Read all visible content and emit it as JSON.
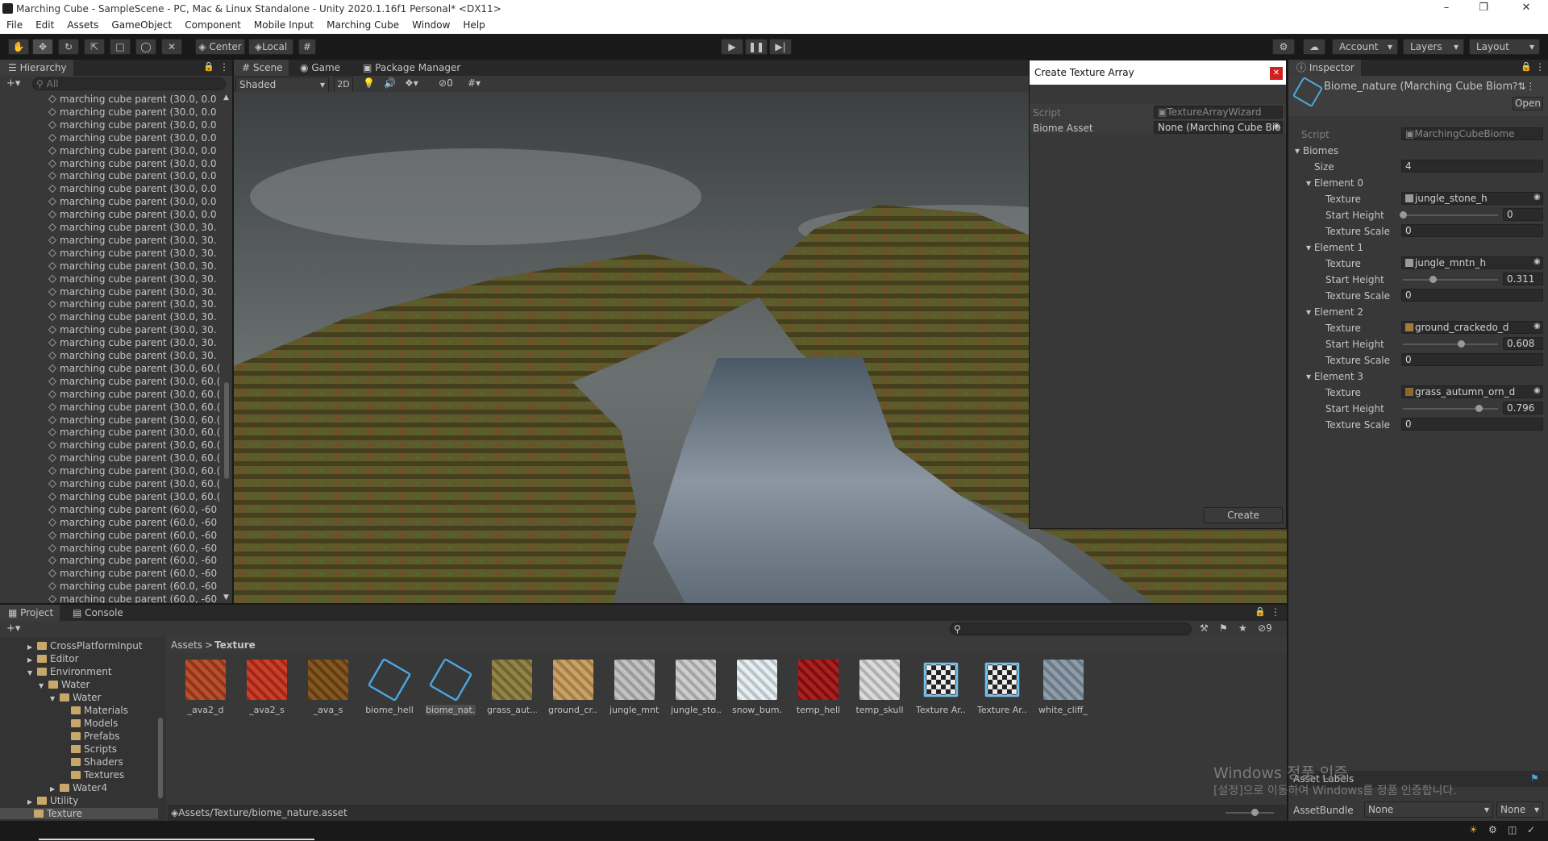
{
  "window": {
    "title": "Marching Cube - SampleScene - PC, Mac & Linux Standalone - Unity 2020.1.16f1 Personal* <DX11>"
  },
  "menu": [
    "File",
    "Edit",
    "Assets",
    "GameObject",
    "Component",
    "Mobile Input",
    "Marching Cube",
    "Window",
    "Help"
  ],
  "toolbar": {
    "pivot": "Center",
    "space": "Local",
    "account": "Account",
    "layers": "Layers",
    "layout": "Layout"
  },
  "hierarchy": {
    "tab": "Hierarchy",
    "search_placeholder": "All",
    "rows": [
      "marching cube parent (30.0, 0.0",
      "marching cube parent (30.0, 0.0",
      "marching cube parent (30.0, 0.0",
      "marching cube parent (30.0, 0.0",
      "marching cube parent (30.0, 0.0",
      "marching cube parent (30.0, 0.0",
      "marching cube parent (30.0, 0.0",
      "marching cube parent (30.0, 0.0",
      "marching cube parent (30.0, 0.0",
      "marching cube parent (30.0, 0.0",
      "marching cube parent (30.0, 30.",
      "marching cube parent (30.0, 30.",
      "marching cube parent (30.0, 30.",
      "marching cube parent (30.0, 30.",
      "marching cube parent (30.0, 30.",
      "marching cube parent (30.0, 30.",
      "marching cube parent (30.0, 30.",
      "marching cube parent (30.0, 30.",
      "marching cube parent (30.0, 30.",
      "marching cube parent (30.0, 30.",
      "marching cube parent (30.0, 30.",
      "marching cube parent (30.0, 60.(",
      "marching cube parent (30.0, 60.(",
      "marching cube parent (30.0, 60.(",
      "marching cube parent (30.0, 60.(",
      "marching cube parent (30.0, 60.(",
      "marching cube parent (30.0, 60.(",
      "marching cube parent (30.0, 60.(",
      "marching cube parent (30.0, 60.(",
      "marching cube parent (30.0, 60.(",
      "marching cube parent (30.0, 60.(",
      "marching cube parent (30.0, 60.(",
      "marching cube parent (60.0, -60",
      "marching cube parent (60.0, -60",
      "marching cube parent (60.0, -60",
      "marching cube parent (60.0, -60",
      "marching cube parent (60.0, -60",
      "marching cube parent (60.0, -60",
      "marching cube parent (60.0, -60",
      "marching cube parent (60.0, -60"
    ]
  },
  "scene": {
    "tabs": [
      "Scene",
      "Game",
      "Package Manager"
    ],
    "shading": "Shaded",
    "mode_2d": "2D",
    "hidden_count": "0"
  },
  "wizard": {
    "title": "Create Texture Array",
    "script_label": "Script",
    "script_value": "TextureArrayWizard",
    "biome_label": "Biome Asset",
    "biome_value": "None (Marching Cube Bio",
    "create": "Create"
  },
  "inspector": {
    "tab": "Inspector",
    "object_name": "Biome_nature (Marching Cube Biom",
    "open": "Open",
    "script_label": "Script",
    "script_value": "MarchingCubeBiome",
    "biomes_label": "Biomes",
    "size_label": "Size",
    "size_value": "4",
    "texture_label": "Texture",
    "start_height_label": "Start Height",
    "texture_scale_label": "Texture Scale",
    "elements": [
      {
        "name": "Element 0",
        "texture": "jungle_stone_h",
        "start_height": "0",
        "start_height_fraction": 0.0,
        "texture_scale": "0",
        "swatch": "#9a9a9a"
      },
      {
        "name": "Element 1",
        "texture": "jungle_mntn_h",
        "start_height": "0.311",
        "start_height_fraction": 0.311,
        "texture_scale": "0",
        "swatch": "#9a9a9a"
      },
      {
        "name": "Element 2",
        "texture": "ground_crackedo_d",
        "start_height": "0.608",
        "start_height_fraction": 0.608,
        "texture_scale": "0",
        "swatch": "#a37a3c"
      },
      {
        "name": "Element 3",
        "texture": "grass_autumn_orn_d",
        "start_height": "0.796",
        "start_height_fraction": 0.796,
        "texture_scale": "0",
        "swatch": "#8a6a2c"
      }
    ],
    "asset_labels": "Asset Labels",
    "asset_bundle_label": "AssetBundle",
    "asset_bundle_value": "None",
    "asset_bundle_variant": "None"
  },
  "project": {
    "tabs": [
      "Project",
      "Console"
    ],
    "breadcrumb": [
      "Assets",
      "Texture"
    ],
    "hidden_count": "9",
    "tree": [
      {
        "label": "CrossPlatformInput",
        "depth": 1,
        "arrow": "▶"
      },
      {
        "label": "Editor",
        "depth": 1,
        "arrow": "▶"
      },
      {
        "label": "Environment",
        "depth": 1,
        "arrow": "▼"
      },
      {
        "label": "Water",
        "depth": 2,
        "arrow": "▼"
      },
      {
        "label": "Water",
        "depth": 3,
        "arrow": "▼"
      },
      {
        "label": "Materials",
        "depth": 4,
        "arrow": ""
      },
      {
        "label": "Models",
        "depth": 4,
        "arrow": ""
      },
      {
        "label": "Prefabs",
        "depth": 4,
        "arrow": ""
      },
      {
        "label": "Scripts",
        "depth": 4,
        "arrow": ""
      },
      {
        "label": "Shaders",
        "depth": 4,
        "arrow": ""
      },
      {
        "label": "Textures",
        "depth": 4,
        "arrow": ""
      },
      {
        "label": "Water4",
        "depth": 3,
        "arrow": "▶"
      },
      {
        "label": "Utility",
        "depth": 1,
        "arrow": "▶"
      },
      {
        "label": "Texture",
        "depth": 0,
        "arrow": ""
      }
    ],
    "assets": [
      {
        "label": "_ava2_d",
        "kind": "tex",
        "color": "#b3411c"
      },
      {
        "label": "_ava2_s",
        "kind": "tex",
        "color": "#c6301a"
      },
      {
        "label": "_ava_s",
        "kind": "tex",
        "color": "#7a4a12"
      },
      {
        "label": "biome_hell",
        "kind": "script",
        "color": ""
      },
      {
        "label": "biome_nat...",
        "kind": "script",
        "color": ""
      },
      {
        "label": "grass_aut...",
        "kind": "tex",
        "color": "#8a7a3a"
      },
      {
        "label": "ground_cr...",
        "kind": "tex",
        "color": "#c79a58"
      },
      {
        "label": "jungle_mnt...",
        "kind": "tex",
        "color": "#bdbdbd"
      },
      {
        "label": "jungle_sto...",
        "kind": "tex",
        "color": "#c9c9c9"
      },
      {
        "label": "snow_bum...",
        "kind": "tex",
        "color": "#e4eef2"
      },
      {
        "label": "temp_hell",
        "kind": "tex",
        "color": "#a01010"
      },
      {
        "label": "temp_skull",
        "kind": "tex",
        "color": "#d8d8d8"
      },
      {
        "label": "Texture Ar...",
        "kind": "array",
        "color": ""
      },
      {
        "label": "Texture Ar...",
        "kind": "array",
        "color": ""
      },
      {
        "label": "white_cliff_...",
        "kind": "tex",
        "color": "#8494a4"
      }
    ],
    "status_path": "Assets/Texture/biome_nature.asset"
  },
  "watermark": {
    "line1": "Windows 정품 인증",
    "line2": "[설정]으로 이동하여 Windows를 정품 인증합니다."
  }
}
